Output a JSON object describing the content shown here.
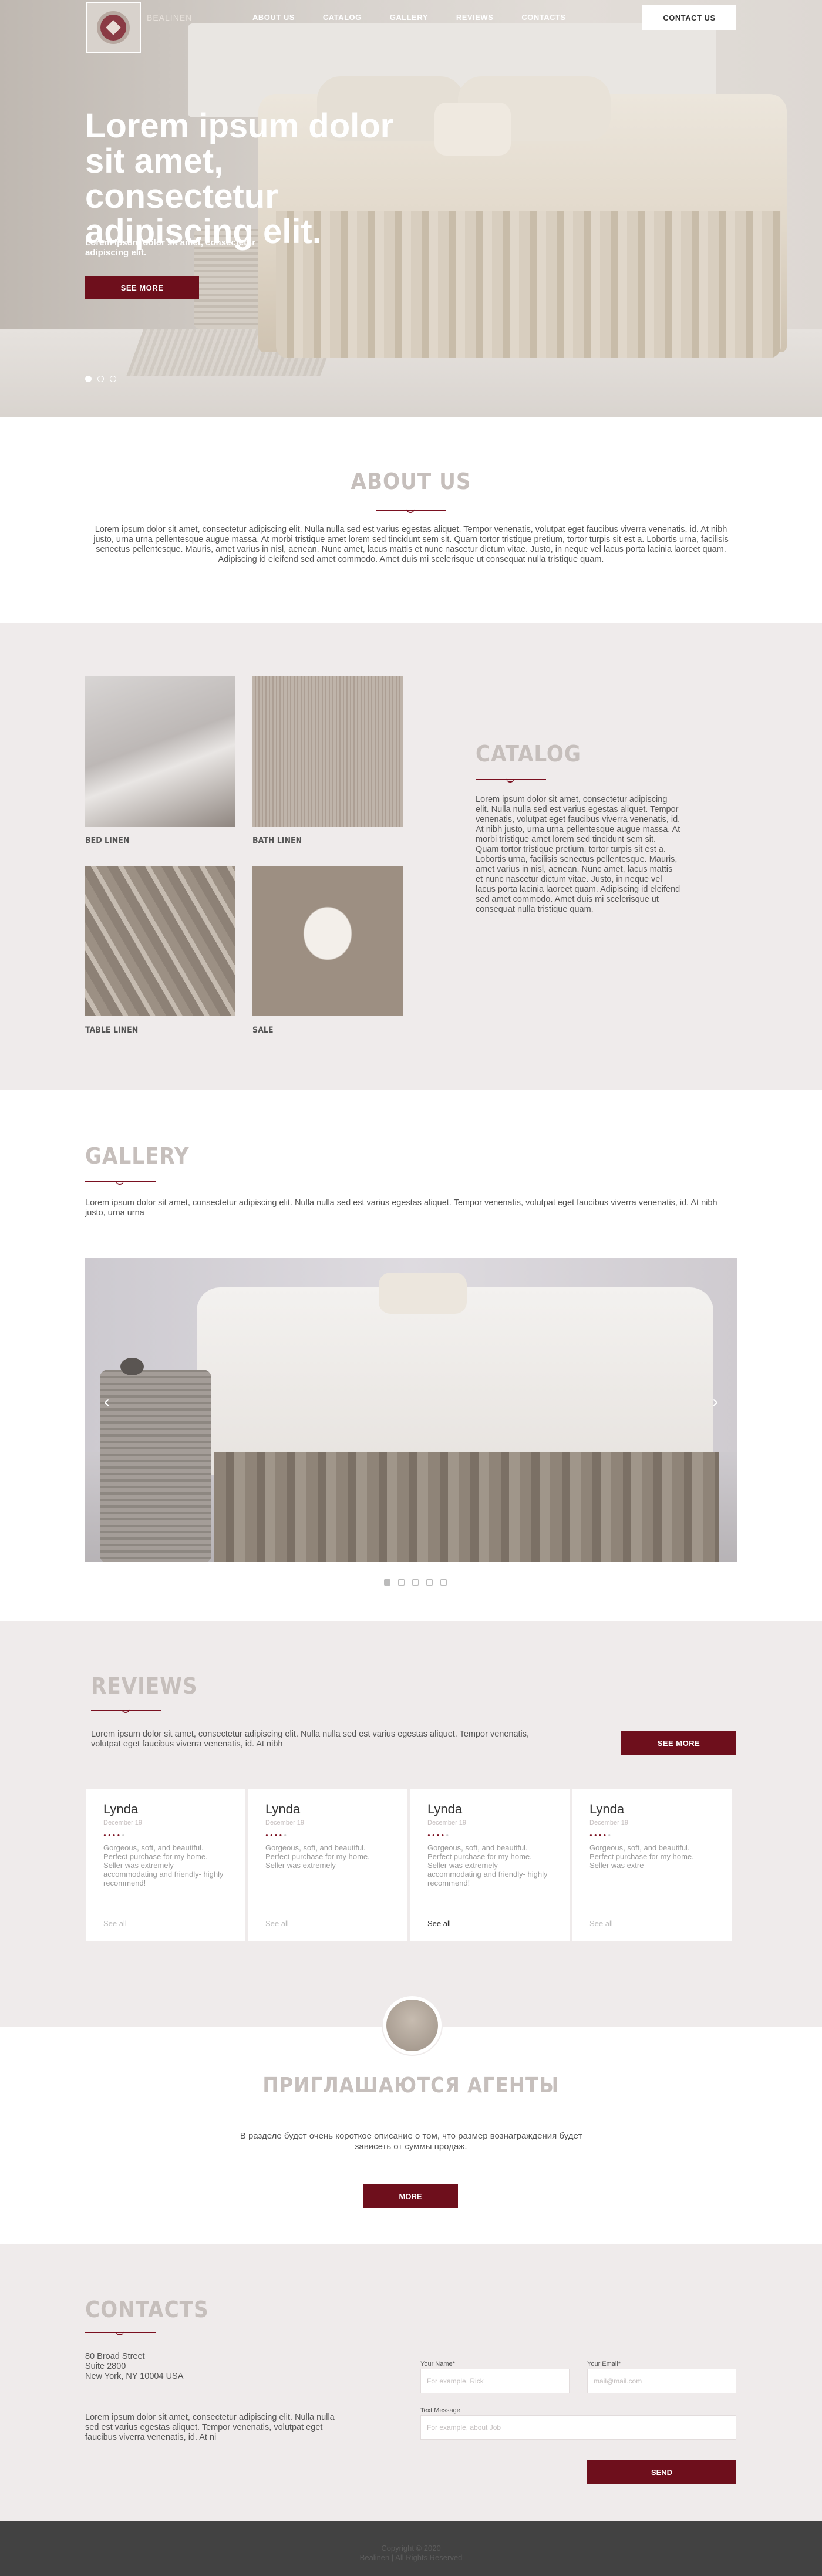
{
  "header": {
    "brand": "BEALINEN",
    "nav": [
      "ABOUT US",
      "CATALOG",
      "GALLERY",
      "REVIEWS",
      "CONTACTS"
    ],
    "contact_button": "CONTACT US"
  },
  "hero": {
    "title": "Lorem ipsum dolor sit amet, consectetur adipiscing elit.",
    "subtitle": "Lorem ipsum dolor sit amet, consectetur adipiscing elit.",
    "button": "SEE MORE",
    "slides_count": 3,
    "active_slide": 1
  },
  "about": {
    "title": "ABOUT US",
    "text": "Lorem ipsum dolor sit amet, consectetur adipiscing elit. Nulla nulla sed est varius egestas aliquet. Tempor venenatis, volutpat eget faucibus viverra venenatis, id. At nibh justo, urna urna pellentesque augue massa. At morbi tristique amet lorem sed tincidunt sem sit. Quam tortor tristique pretium, tortor turpis sit est a. Lobortis urna, facilisis senectus pellentesque. Mauris, amet varius in nisl, aenean. Nunc amet, lacus mattis et nunc nascetur dictum vitae. Justo, in neque vel lacus porta lacinia laoreet quam. Adipiscing id eleifend sed amet commodo. Amet duis mi scelerisque ut consequat nulla tristique quam."
  },
  "catalog": {
    "title": "CATALOG",
    "items": [
      "BED LINEN",
      "BATH LINEN",
      "TABLE LINEN",
      "SALE"
    ],
    "text": "Lorem ipsum dolor sit amet, consectetur adipiscing elit. Nulla nulla sed est varius egestas aliquet. Tempor venenatis, volutpat eget faucibus viverra venenatis, id. At nibh justo, urna urna pellentesque augue massa. At morbi tristique amet lorem sed tincidunt sem sit. Quam tortor tristique pretium, tortor turpis sit est a. Lobortis urna, facilisis senectus pellentesque. Mauris, amet varius in nisl, aenean. Nunc amet, lacus mattis et nunc nascetur dictum vitae. Justo, in neque vel lacus porta lacinia laoreet quam. Adipiscing id eleifend sed amet commodo. Amet duis mi scelerisque ut consequat nulla tristique quam."
  },
  "gallery": {
    "title": "GALLERY",
    "text": "Lorem ipsum dolor sit amet, consectetur adipiscing elit. Nulla nulla sed est varius egestas aliquet. Tempor venenatis, volutpat eget faucibus viverra venenatis, id. At nibh justo, urna urna",
    "prev_icon": "chevron-left-icon",
    "next_icon": "chevron-right-icon",
    "slides_count": 5,
    "active_slide": 1
  },
  "reviews": {
    "title": "REVIEWS",
    "text": "Lorem ipsum dolor sit amet, consectetur adipiscing elit. Nulla nulla sed est varius egestas aliquet. Tempor venenatis, volutpat eget faucibus viverra venenatis, id. At nibh",
    "button": "SEE MORE",
    "cards": [
      {
        "name": "Lynda",
        "date": "December 19",
        "rating": 4,
        "body": "Gorgeous, soft, and beautiful. Perfect purchase for my home. Seller was extremely accommodating and friendly- highly recommend!",
        "link": "See all"
      },
      {
        "name": "Lynda",
        "date": "December 19",
        "rating": 4,
        "body": "Gorgeous, soft, and beautiful. Perfect purchase for my home. Seller was extremely",
        "link": "See all"
      },
      {
        "name": "Lynda",
        "date": "December 19",
        "rating": 4,
        "body": "Gorgeous, soft, and beautiful. Perfect purchase for my home. Seller was extremely accommodating and friendly- highly recommend!",
        "link": "See all"
      },
      {
        "name": "Lynda",
        "date": "December 19",
        "rating": 4,
        "body": "Gorgeous, soft, and beautiful. Perfect purchase for my home. Seller was extre",
        "link": "See all"
      }
    ]
  },
  "agents": {
    "title": "ПРИГЛАШАЮТСЯ АГЕНТЫ",
    "text": "В разделе будет очень короткое описание о том, что размер вознаграждения будет зависеть от суммы продаж.",
    "button": "MORE"
  },
  "contacts": {
    "title": "CONTACTS",
    "address": [
      "80 Broad Street",
      "Suite 2800",
      "New York, NY 10004 USA"
    ],
    "text": "Lorem ipsum dolor sit amet, consectetur adipiscing elit. Nulla nulla sed est varius egestas aliquet. Tempor venenatis, volutpat eget faucibus viverra venenatis, id. At ni",
    "form": {
      "name_label": "Your Name*",
      "name_placeholder": "For example, Rick",
      "email_label": "Your Email*",
      "email_placeholder": "mail@mail.com",
      "message_label": "Text Message",
      "message_placeholder": "For example, about Job",
      "send_button": "SEND"
    }
  },
  "footer": {
    "copyright": "Copyright © 2020",
    "rights": "Bealinen | All Rights Reserved"
  },
  "colors": {
    "accent": "#6e0f1c",
    "section_bg": "#efebeb",
    "title": "#c6bfbc",
    "footer_bg": "#424242"
  }
}
